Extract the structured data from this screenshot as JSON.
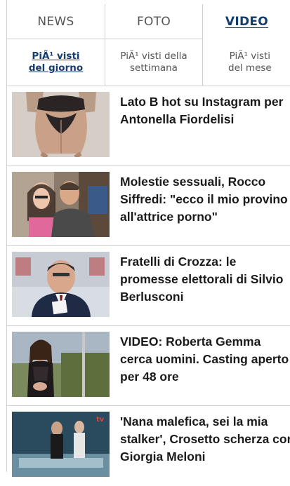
{
  "main_tabs": [
    {
      "label": "NEWS"
    },
    {
      "label": "FOTO"
    },
    {
      "label": "VIDEO"
    }
  ],
  "sub_tabs": [
    {
      "line1": "PiÃ¹ visti",
      "line2": "del giorno"
    },
    {
      "line1": "PiÃ¹ visti della",
      "line2": "settimana"
    },
    {
      "line1": "PiÃ¹ visti",
      "line2": "del mese"
    }
  ],
  "videos": [
    {
      "line1": "Lato B hot su Instagram per",
      "line2": "Antonella Fiordelisi",
      "line3": ""
    },
    {
      "line1": "Molestie sessuali, Rocco",
      "line2": "Siffredi: \"ecco il mio provino",
      "line3": "all'attrice porno\""
    },
    {
      "line1": "Fratelli di Crozza: le",
      "line2": "promesse elettorali di Silvio",
      "line3": "Berlusconi"
    },
    {
      "line1": "VIDEO: Roberta Gemma",
      "line2": "cerca uomini. Casting aperto",
      "line3": "per 48 ore"
    },
    {
      "line1": "'Nana malefica, sei la mia",
      "line2": "stalker', Crosetto scherza con",
      "line3": "Giorgia Meloni"
    }
  ]
}
